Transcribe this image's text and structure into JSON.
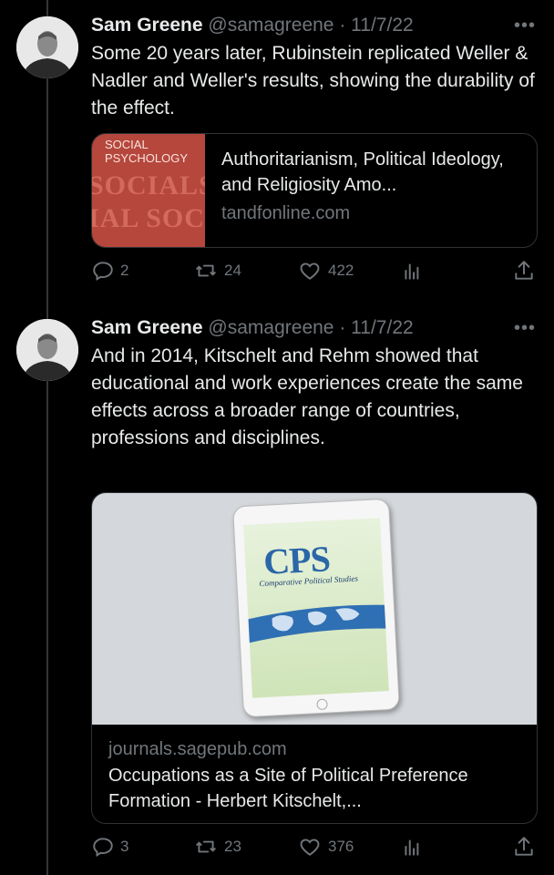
{
  "tweets": [
    {
      "author": "Sam Greene",
      "handle": "@samagreene",
      "separator": "·",
      "date": "11/7/22",
      "more": "•••",
      "text": "Some 20 years later, Rubinstein replicated Weller & Nadler and Weller's results, showing the durability of the effect.",
      "card": {
        "thumb_top": "SOCIAL PSYCHOLOGY",
        "thumb_bg_text_1": "SOCIALS",
        "thumb_bg_text_2": "IAL SOC",
        "title": "Authoritarianism, Political Ideology, and Religiosity Amo...",
        "domain": "tandfonline.com"
      },
      "actions": {
        "replies": "2",
        "retweets": "24",
        "likes": "422"
      }
    },
    {
      "author": "Sam Greene",
      "handle": "@samagreene",
      "separator": "·",
      "date": "11/7/22",
      "more": "•••",
      "text": "And in 2014, Kitschelt and Rehm showed that educational and work experiences create the same effects across a broader range of countries, professions and disciplines.",
      "card": {
        "logo": "CPS",
        "subtitle": "Comparative Political Studies",
        "domain": "journals.sagepub.com",
        "title": "Occupations as a Site of Political Preference Formation - Herbert Kitschelt,..."
      },
      "actions": {
        "replies": "3",
        "retweets": "23",
        "likes": "376"
      }
    }
  ],
  "icons": [
    "reply-icon",
    "retweet-icon",
    "like-icon",
    "views-icon",
    "share-icon"
  ],
  "colors": {
    "background": "#000000",
    "text": "#e7e9ea",
    "muted": "#71767b",
    "border": "#2f3336"
  }
}
